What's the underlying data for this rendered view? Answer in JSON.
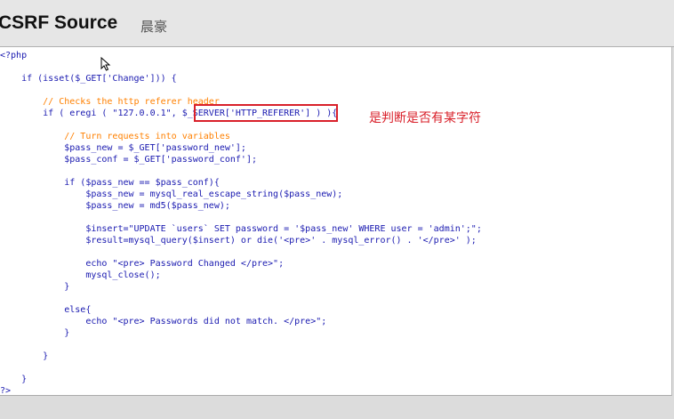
{
  "header": {
    "title": "CSRF Source",
    "author": "晨豪"
  },
  "code": {
    "lines": [
      "<?php",
      "",
      "    if (isset($_GET['Change'])) {",
      "",
      "        // Checks the http referer header",
      "        if ( eregi ( \"127.0.0.1\", $_SERVER['HTTP_REFERER'] ) ){",
      "",
      "            // Turn requests into variables",
      "            $pass_new = $_GET['password_new'];",
      "            $pass_conf = $_GET['password_conf'];",
      "",
      "            if ($pass_new == $pass_conf){",
      "                $pass_new = mysql_real_escape_string($pass_new);",
      "                $pass_new = md5($pass_new);",
      "",
      "                $insert=\"UPDATE `users` SET password = '$pass_new' WHERE user = 'admin';\";",
      "                $result=mysql_query($insert) or die('<pre>' . mysql_error() . '</pre>' );",
      "",
      "                echo \"<pre> Password Changed </pre>\";",
      "                mysql_close();",
      "            }",
      "",
      "            else{",
      "                echo \"<pre> Passwords did not match. </pre>\";",
      "            }",
      "",
      "        }",
      "",
      "    }",
      "?>"
    ]
  },
  "annotation": {
    "text": "是判断是否有某字符"
  }
}
